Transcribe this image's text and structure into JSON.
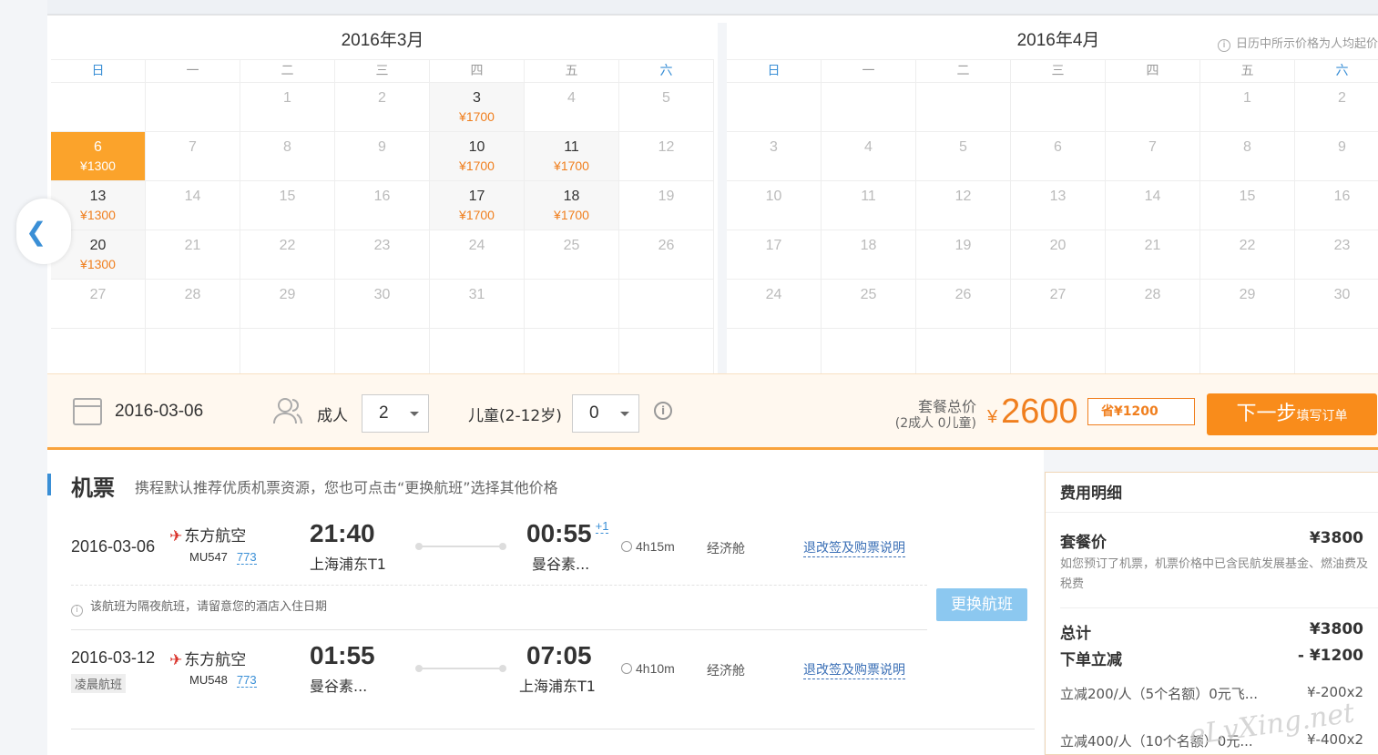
{
  "calendar": {
    "note": "日历中所示价格为人均起价",
    "weekdays": [
      "日",
      "一",
      "二",
      "三",
      "四",
      "五",
      "六"
    ],
    "months": [
      {
        "title": "2016年3月",
        "cells": [
          {
            "d": "",
            "p": ""
          },
          {
            "d": "",
            "p": ""
          },
          {
            "d": "1",
            "p": ""
          },
          {
            "d": "2",
            "p": ""
          },
          {
            "d": "3",
            "p": "¥1700"
          },
          {
            "d": "4",
            "p": ""
          },
          {
            "d": "5",
            "p": ""
          },
          {
            "d": "6",
            "p": "¥1300",
            "sel": true
          },
          {
            "d": "7",
            "p": ""
          },
          {
            "d": "8",
            "p": ""
          },
          {
            "d": "9",
            "p": ""
          },
          {
            "d": "10",
            "p": "¥1700"
          },
          {
            "d": "11",
            "p": "¥1700"
          },
          {
            "d": "12",
            "p": ""
          },
          {
            "d": "13",
            "p": "¥1300"
          },
          {
            "d": "14",
            "p": ""
          },
          {
            "d": "15",
            "p": ""
          },
          {
            "d": "16",
            "p": ""
          },
          {
            "d": "17",
            "p": "¥1700"
          },
          {
            "d": "18",
            "p": "¥1700"
          },
          {
            "d": "19",
            "p": ""
          },
          {
            "d": "20",
            "p": "¥1300"
          },
          {
            "d": "21",
            "p": ""
          },
          {
            "d": "22",
            "p": ""
          },
          {
            "d": "23",
            "p": ""
          },
          {
            "d": "24",
            "p": ""
          },
          {
            "d": "25",
            "p": ""
          },
          {
            "d": "26",
            "p": ""
          },
          {
            "d": "27",
            "p": ""
          },
          {
            "d": "28",
            "p": ""
          },
          {
            "d": "29",
            "p": ""
          },
          {
            "d": "30",
            "p": ""
          },
          {
            "d": "31",
            "p": ""
          },
          {
            "d": "",
            "p": ""
          },
          {
            "d": "",
            "p": ""
          },
          {
            "d": "",
            "p": ""
          },
          {
            "d": "",
            "p": ""
          },
          {
            "d": "",
            "p": ""
          },
          {
            "d": "",
            "p": ""
          },
          {
            "d": "",
            "p": ""
          },
          {
            "d": "",
            "p": ""
          },
          {
            "d": "",
            "p": ""
          }
        ]
      },
      {
        "title": "2016年4月",
        "cells": [
          {
            "d": "",
            "p": ""
          },
          {
            "d": "",
            "p": ""
          },
          {
            "d": "",
            "p": ""
          },
          {
            "d": "",
            "p": ""
          },
          {
            "d": "",
            "p": ""
          },
          {
            "d": "1",
            "p": ""
          },
          {
            "d": "2",
            "p": ""
          },
          {
            "d": "3",
            "p": ""
          },
          {
            "d": "4",
            "p": ""
          },
          {
            "d": "5",
            "p": ""
          },
          {
            "d": "6",
            "p": ""
          },
          {
            "d": "7",
            "p": ""
          },
          {
            "d": "8",
            "p": ""
          },
          {
            "d": "9",
            "p": ""
          },
          {
            "d": "10",
            "p": ""
          },
          {
            "d": "11",
            "p": ""
          },
          {
            "d": "12",
            "p": ""
          },
          {
            "d": "13",
            "p": ""
          },
          {
            "d": "14",
            "p": ""
          },
          {
            "d": "15",
            "p": ""
          },
          {
            "d": "16",
            "p": ""
          },
          {
            "d": "17",
            "p": ""
          },
          {
            "d": "18",
            "p": ""
          },
          {
            "d": "19",
            "p": ""
          },
          {
            "d": "20",
            "p": ""
          },
          {
            "d": "21",
            "p": ""
          },
          {
            "d": "22",
            "p": ""
          },
          {
            "d": "23",
            "p": ""
          },
          {
            "d": "24",
            "p": ""
          },
          {
            "d": "25",
            "p": ""
          },
          {
            "d": "26",
            "p": ""
          },
          {
            "d": "27",
            "p": ""
          },
          {
            "d": "28",
            "p": ""
          },
          {
            "d": "29",
            "p": ""
          },
          {
            "d": "30",
            "p": ""
          },
          {
            "d": "",
            "p": ""
          },
          {
            "d": "",
            "p": ""
          },
          {
            "d": "",
            "p": ""
          },
          {
            "d": "",
            "p": ""
          },
          {
            "d": "",
            "p": ""
          },
          {
            "d": "",
            "p": ""
          },
          {
            "d": "",
            "p": ""
          }
        ]
      }
    ]
  },
  "booking": {
    "date": "2016-03-06",
    "adult_label": "成人",
    "adult_value": "2",
    "child_label": "儿童(2-12岁)",
    "child_value": "0",
    "total_label": "套餐总价",
    "total_sub": "(2成人 0儿童)",
    "currency": "¥",
    "total_price": "2600",
    "save_tag": "省¥1200",
    "next_main": "下一步",
    "next_sub": "填写订单"
  },
  "flights": {
    "title": "机票",
    "desc": "携程默认推荐优质机票资源，您也可点击“更换航班”选择其他价格",
    "items": [
      {
        "date": "2016-03-06",
        "airline": "东方航空",
        "flight_no": "MU547",
        "plane": "773",
        "dep_time": "21:40",
        "dep_airport": "上海浦东T1",
        "arr_time": "00:55",
        "arr_plus": "+1",
        "arr_airport": "曼谷素...",
        "duration": "4h15m",
        "cabin": "经济舱",
        "refund": "退改签及购票说明"
      },
      {
        "date": "2016-03-12",
        "airline": "东方航空",
        "flight_no": "MU548",
        "plane": "773",
        "dep_time": "01:55",
        "dep_airport": "曼谷素...",
        "arr_time": "07:05",
        "arr_plus": "",
        "arr_airport": "上海浦东T1",
        "duration": "4h10m",
        "cabin": "经济舱",
        "refund": "退改签及购票说明",
        "tag": "凌晨航班"
      }
    ],
    "notice": "该航班为隔夜航班，请留意您的酒店入住日期",
    "change_button": "更换航班"
  },
  "fees": {
    "title": "费用明细",
    "package_label": "套餐价",
    "package_value": "¥3800",
    "package_note": "如您预订了机票，机票价格中已含民航发展基金、燃油费及税费",
    "total_label": "总计",
    "total_value": "¥3800",
    "discount_label": "下单立减",
    "discount_value": "- ¥1200",
    "items": [
      {
        "label": "立减200/人（5个名额）0元飞...",
        "value": "¥-200x2"
      },
      {
        "label": "立减400/人（10个名额）0元...",
        "value": "¥-400x2"
      }
    ]
  },
  "watermark": "eLvXing.net",
  "colors": {
    "accent": "#f98c1b",
    "blue": "#3a8fd6",
    "price": "#f07f1e"
  }
}
